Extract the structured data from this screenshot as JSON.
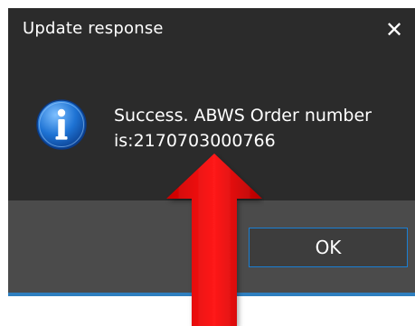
{
  "dialog": {
    "title": "Update response",
    "close_glyph": "✕",
    "message": "Success. ABWS Order number is:2170703000766",
    "icon": "info-icon",
    "ok_label": "OK"
  },
  "annotation": {
    "arrow_color": "#e00000"
  },
  "colors": {
    "dialog_background": "#2b2b2b",
    "footer_background": "#4b4b4b",
    "button_border_accent": "#1a7fd4",
    "info_icon_blue": "#1e73d4"
  }
}
